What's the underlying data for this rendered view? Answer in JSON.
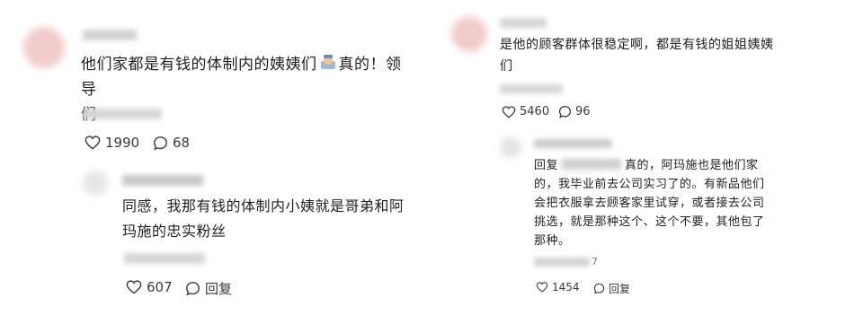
{
  "left": {
    "comment": {
      "text_line1": "他们家都是有钱的体制内的姨姨们",
      "text_line1_after": "真的！领导",
      "text_line2": "们",
      "likes": "1990",
      "replies": "68"
    },
    "reply": {
      "text_line1": "同感，我那有钱的体制内小姨就是哥弟和阿",
      "text_line2": "玛施的忠实粉丝",
      "likes": "607",
      "reply_label": "回复"
    }
  },
  "right": {
    "comment": {
      "text_line1": "是他的顾客群体很稳定啊，都是有钱的姐姐姨姨",
      "text_line2": "们",
      "likes": "5460",
      "replies": "96"
    },
    "reply": {
      "prefix": "回复",
      "line1_after": "真的，阿玛施也是他们家",
      "text_line2": "的，我毕业前去公司实习了的。有新品他们",
      "text_line3": "会把衣服拿去顾客家里试穿，或者接去公司",
      "text_line4": "挑选，就是那种这个、这个不要，其他包了",
      "text_line5": "那种。",
      "date_suffix": "7",
      "likes": "1454",
      "reply_label": "回复"
    }
  },
  "colors": {
    "text": "#1f1f1f",
    "meta": "#3a3a3a",
    "avatar_pink": "#f2cccc",
    "blur_gray": "#c8c8c8"
  }
}
